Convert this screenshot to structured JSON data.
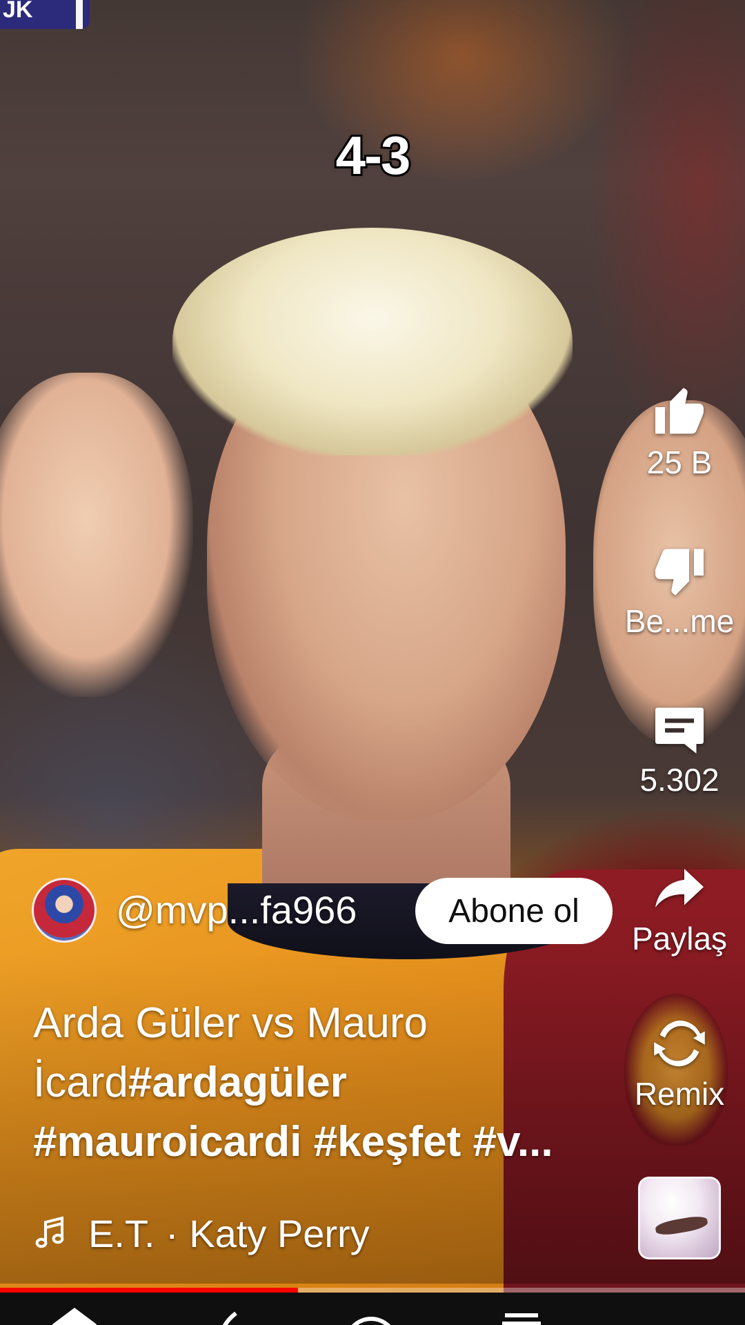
{
  "video": {
    "score_badge_text": "JK",
    "scoreline": "4-3",
    "progress_fraction": 0.4
  },
  "actions": {
    "like": {
      "icon": "thumb-up-icon",
      "label": "25 B"
    },
    "dislike": {
      "icon": "thumb-down-icon",
      "label": "Be...me"
    },
    "comments": {
      "icon": "comment-icon",
      "label": "5.302"
    },
    "share": {
      "icon": "share-icon",
      "label": "Paylaş"
    },
    "remix": {
      "icon": "remix-icon",
      "label": "Remix"
    }
  },
  "channel": {
    "handle": "@mvp...fa966",
    "subscribe_label": "Abone ol"
  },
  "title": {
    "line1": "Arda Güler vs Mauro",
    "line2_plain": "İcard",
    "line2_tag": "#ardagüler",
    "line3": "#mauroicardi #keşfet #v..."
  },
  "music": {
    "icon": "music-note-icon",
    "text": "E.T. · Katy Perry"
  },
  "colors": {
    "progress": "#ff0000",
    "subscribe_bg": "#ffffff",
    "nav_bg": "#0f0f0f"
  }
}
